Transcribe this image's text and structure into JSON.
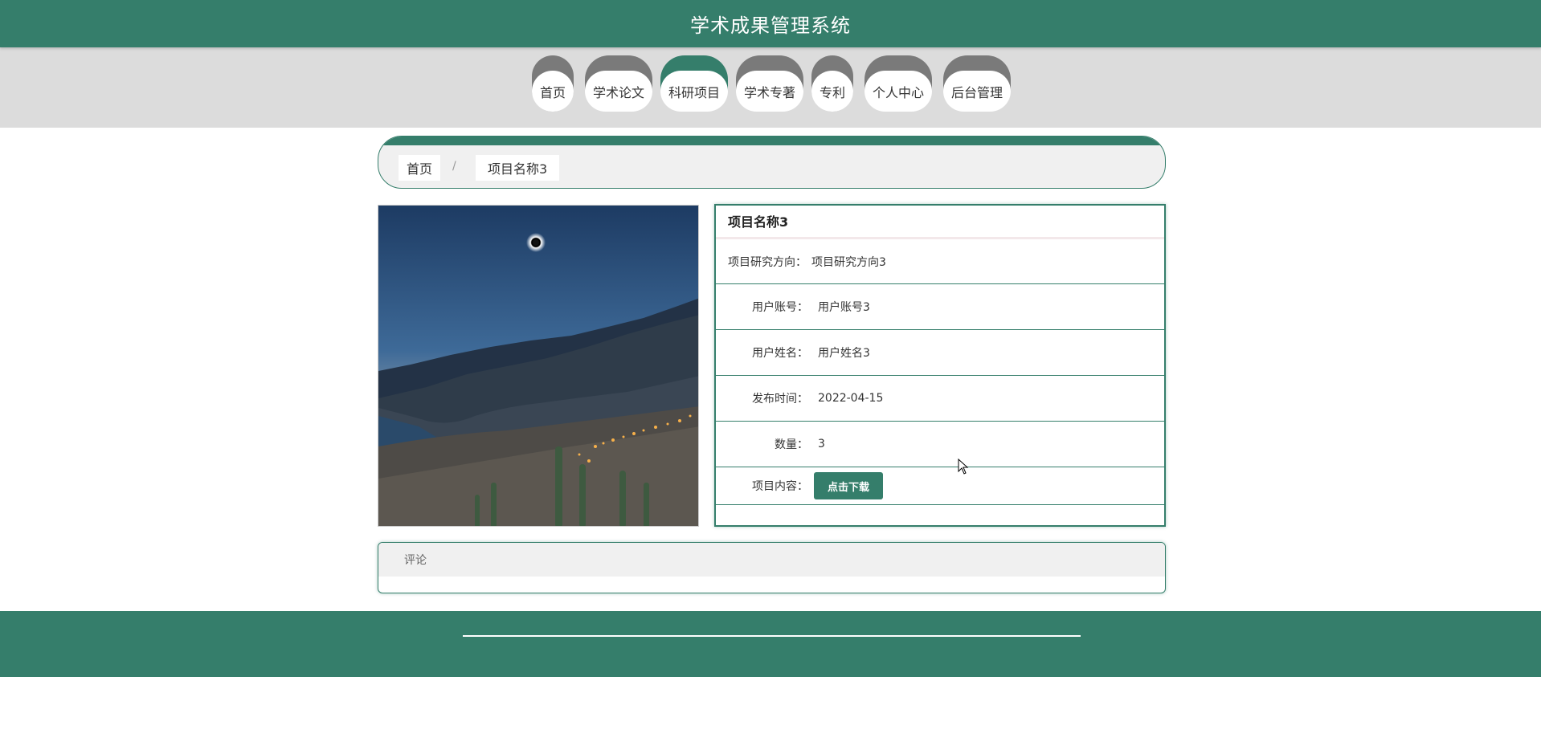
{
  "header": {
    "title": "学术成果管理系统"
  },
  "nav": {
    "items": [
      {
        "label": "首页"
      },
      {
        "label": "学术论文"
      },
      {
        "label": "科研项目"
      },
      {
        "label": "学术专著"
      },
      {
        "label": "专利"
      },
      {
        "label": "个人中心"
      },
      {
        "label": "后台管理"
      }
    ],
    "active": "科研项目",
    "active_color": "#357e6b"
  },
  "breadcrumb": {
    "home": "首页",
    "separator": "/",
    "current": "项目名称3"
  },
  "detail": {
    "title": "项目名称3",
    "fields": [
      {
        "label": "项目研究方向：",
        "value": "项目研究方向3"
      },
      {
        "label": "用户账号：",
        "value": "用户账号3"
      },
      {
        "label": "用户姓名：",
        "value": "用户姓名3"
      },
      {
        "label": "发布时间：",
        "value": "2022-04-15"
      },
      {
        "label": "数量：",
        "value": "3"
      }
    ],
    "content_label": "项目内容：",
    "download_label": "点击下载"
  },
  "comment": {
    "title": "评论"
  },
  "colors": {
    "brand": "#357e6b",
    "nav_bg": "#dcdcdc"
  }
}
